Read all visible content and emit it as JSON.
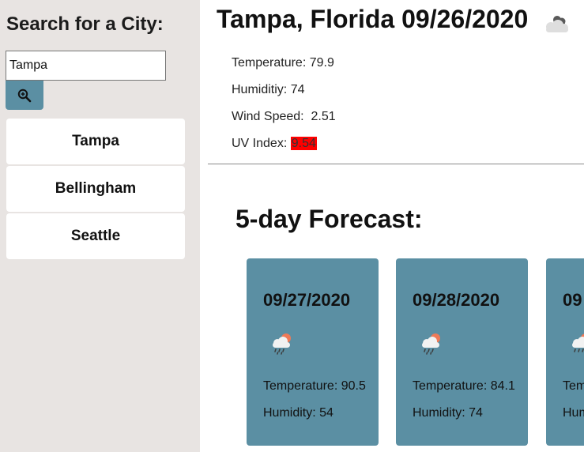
{
  "sidebar": {
    "title": "Search for a City:",
    "search_value": "Tampa",
    "search_icon": "search-zoom-icon",
    "cities": [
      "Tampa",
      "Bellingham",
      "Seattle"
    ]
  },
  "current": {
    "header": "Tampa, Florida 09/26/2020",
    "icon": "cloudy-icon",
    "temperature_label": "Temperature:",
    "temperature": "79.9",
    "humidity_label": "Humiditiy:",
    "humidity": "74",
    "wind_label": "Wind Speed:",
    "wind": "2.51",
    "uv_label": "UV Index:",
    "uv": "9.54"
  },
  "forecast": {
    "title": "5-day Forecast:",
    "days": [
      {
        "date": "09/27/2020",
        "temperature": "Temperature: 90.5",
        "humidity": "Humidity: 54",
        "icon": "rain-sun-icon"
      },
      {
        "date": "09/28/2020",
        "temperature": "Temperature: 84.1",
        "humidity": "Humidity: 74",
        "icon": "rain-sun-icon"
      },
      {
        "date": "09",
        "temperature": "Tem",
        "humidity": "Hum",
        "icon": "rain-sun-icon"
      }
    ]
  },
  "colors": {
    "sidebar_bg": "#e8e4e2",
    "accent": "#5b8fa3",
    "uv_highlight": "#ff0000"
  }
}
